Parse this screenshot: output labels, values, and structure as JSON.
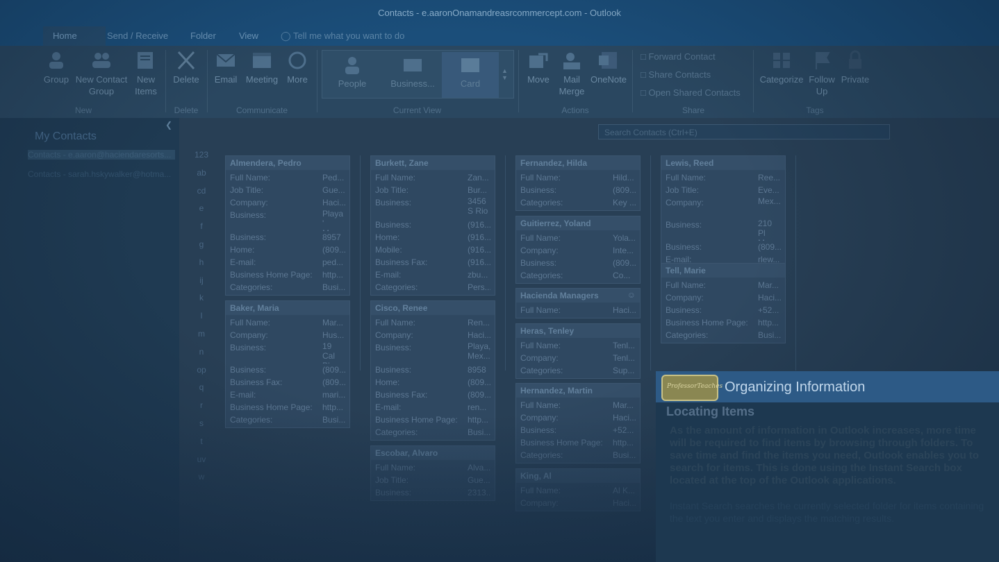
{
  "window": {
    "title": "Contacts - e.aaronOnamandreasrcommercept.com - Outlook"
  },
  "menu": {
    "tabs": [
      "Home",
      "Send / Receive",
      "Folder",
      "View"
    ],
    "tell_me": "Tell me what you want to do"
  },
  "ribbon": {
    "new": {
      "new_group": "Group",
      "new_contact_group": "New Contact Group",
      "new_items": "New Items",
      "label": "New"
    },
    "delete": {
      "delete": "Delete",
      "label": "Delete"
    },
    "communicate": {
      "email": "Email",
      "meeting": "Meeting",
      "more": "More",
      "label": "Communicate"
    },
    "current_view": {
      "people": "People",
      "business": "Business...",
      "card": "Card",
      "label": "Current View"
    },
    "actions": {
      "move": "Move",
      "mail_merge": "Mail Merge",
      "onenote": "OneNote",
      "label": "Actions"
    },
    "share": {
      "forward": "Forward Contact",
      "share": "Share Contacts",
      "open_shared": "Open Shared Contacts",
      "label": "Share"
    },
    "tags": {
      "categorize": "Categorize",
      "follow_up": "Follow Up",
      "private": "Private",
      "label": "Tags"
    }
  },
  "search": {
    "placeholder": "Search Contacts (Ctrl+E)"
  },
  "sidebar": {
    "header": "My Contacts",
    "accounts": [
      "Contacts - e.aaron@haciendaresorts...",
      "Contacts - sarah.hskywalker@hotma..."
    ]
  },
  "alpha_index": [
    "123",
    "ab",
    "cd",
    "e",
    "f",
    "g",
    "h",
    "ij",
    "k",
    "l",
    "m",
    "n",
    "op",
    "q",
    "r",
    "s",
    "t",
    "uv",
    "w"
  ],
  "cards": {
    "almendera": {
      "name": "Almendera, Pedro",
      "rows": [
        [
          "Full Name:",
          "Ped..."
        ],
        [
          "Job Title:",
          "Gue..."
        ],
        [
          "Company:",
          "Haci..."
        ],
        [
          "Business:",
          "Playa ' Mex..."
        ],
        [
          "Business:",
          "8957"
        ],
        [
          "Home:",
          "(809..."
        ],
        [
          "E-mail:",
          "ped..."
        ],
        [
          "Business Home Page:",
          "http..."
        ],
        [
          "Categories:",
          "Busi..."
        ]
      ]
    },
    "baker": {
      "name": "Baker, Maria",
      "rows": [
        [
          "Full Name:",
          "Mar..."
        ],
        [
          "Company:",
          "Hus..."
        ],
        [
          "Business:",
          "19 Cal Playa ' Mex..."
        ],
        [
          "Business:",
          "(809..."
        ],
        [
          "Business Fax:",
          "(809..."
        ],
        [
          "E-mail:",
          "mari..."
        ],
        [
          "Business Home Page:",
          "http..."
        ],
        [
          "Categories:",
          "Busi..."
        ]
      ]
    },
    "burkett": {
      "name": "Burkett, Zane",
      "rows": [
        [
          "Full Name:",
          "Zan..."
        ],
        [
          "Job Title:",
          "Bur..."
        ],
        [
          "Business:",
          "3456 S Rio ..."
        ],
        [
          "Business:",
          "(916..."
        ],
        [
          "Home:",
          "(916..."
        ],
        [
          "Mobile:",
          "(916..."
        ],
        [
          "Business Fax:",
          "(916..."
        ],
        [
          "E-mail:",
          "zbu..."
        ],
        [
          "Categories:",
          "Pers..."
        ]
      ]
    },
    "cisco": {
      "name": "Cisco, Renee",
      "rows": [
        [
          "Full Name:",
          "Ren..."
        ],
        [
          "Company:",
          "Haci..."
        ],
        [
          "Business:",
          "Playa, Mex..."
        ],
        [
          "Business:",
          "8958"
        ],
        [
          "Home:",
          "(809..."
        ],
        [
          "Business Fax:",
          "(809..."
        ],
        [
          "E-mail:",
          "ren..."
        ],
        [
          "Business Home Page:",
          "http..."
        ],
        [
          "Categories:",
          "Busi..."
        ]
      ]
    },
    "escobar": {
      "name": "Escobar, Alvaro",
      "rows": [
        [
          "Full Name:",
          "Alva..."
        ],
        [
          "Job Title:",
          "Gue..."
        ],
        [
          "Business:",
          "2313..."
        ]
      ]
    },
    "fernandez": {
      "name": "Fernandez, Hilda",
      "rows": [
        [
          "Full Name:",
          "Hild..."
        ],
        [
          "Business:",
          "(809..."
        ],
        [
          "Categories:",
          "Key ..."
        ]
      ]
    },
    "guitierrez": {
      "name": "Guitierrez, Yoland",
      "rows": [
        [
          "Full Name:",
          "Yola..."
        ],
        [
          "Company:",
          "Inte..."
        ],
        [
          "Business:",
          "(809..."
        ],
        [
          "Categories:",
          "Co..."
        ]
      ]
    },
    "hacienda": {
      "name": "Hacienda Managers",
      "rows": [
        [
          "Full Name:",
          "Haci..."
        ]
      ]
    },
    "heras": {
      "name": "Heras, Tenley",
      "rows": [
        [
          "Full Name:",
          "Tenl..."
        ],
        [
          "Company:",
          "Tenl..."
        ],
        [
          "Categories:",
          "Sup..."
        ]
      ]
    },
    "hernandez": {
      "name": "Hernandez, Martin",
      "rows": [
        [
          "Full Name:",
          "Mar..."
        ],
        [
          "Company:",
          "Haci..."
        ],
        [
          "Business:",
          "+52..."
        ],
        [
          "Business Home Page:",
          "http..."
        ],
        [
          "Categories:",
          "Busi..."
        ]
      ]
    },
    "king": {
      "name": "King, Al",
      "rows": [
        [
          "Full Name:",
          "Al K..."
        ],
        [
          "Company:",
          "Haci..."
        ]
      ]
    },
    "lewis": {
      "name": "Lewis, Reed",
      "rows": [
        [
          "Full Name:",
          "Ree..."
        ],
        [
          "Job Title:",
          "Eve..."
        ],
        [
          "Company:",
          "Mex..."
        ],
        [
          "Business:",
          "210 Pl Mex..."
        ],
        [
          "Business:",
          "(809..."
        ],
        [
          "E-mail:",
          "rlew..."
        ]
      ]
    },
    "tell": {
      "name": "Tell, Marie",
      "rows": [
        [
          "Full Name:",
          "Mar..."
        ],
        [
          "Company:",
          "Haci..."
        ],
        [
          "Business:",
          "+52..."
        ],
        [
          "Business Home Page:",
          "http..."
        ],
        [
          "Categories:",
          "Busi..."
        ]
      ]
    }
  },
  "info_panel": {
    "title": "Organizing Information",
    "logo_text": "ProfessorTeaches",
    "subtitle": "Locating Items",
    "body": "As the amount of information in Outlook increases, more time will be required to find items by browsing through folders. To save time and find the items you need, Outlook enables you to search for items. This is done using the Instant Search box located at the top of the Outlook applications.",
    "body2": "Instant Search searches the currently selected folder for items containing the text you enter and displays the matching results."
  },
  "colors": {
    "ribbon_blue": "#1b4e7a",
    "panel_bar": "#2d5a86"
  }
}
